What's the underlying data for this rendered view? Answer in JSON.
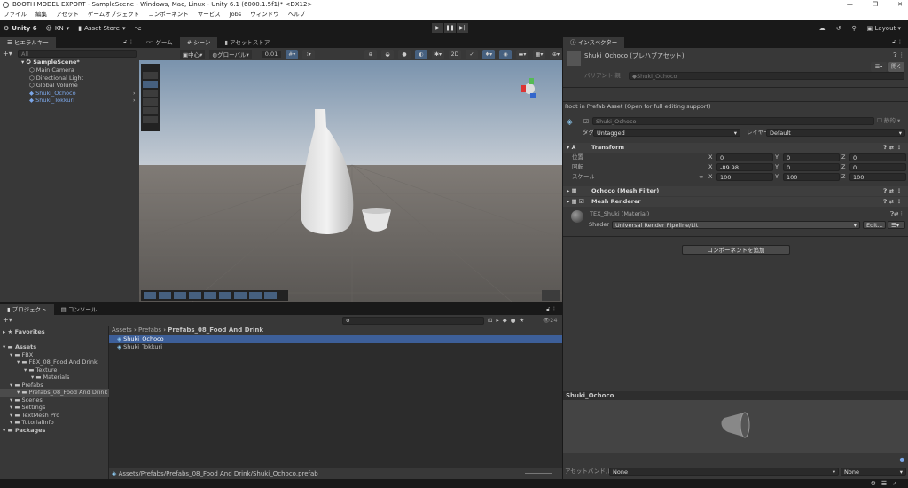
{
  "window": {
    "title": "BOOTH MODEL EXPORT - SampleScene - Windows, Mac, Linux - Unity 6.1 (6000.1.5f1)* <DX12>",
    "controls": [
      "—",
      "❐",
      "✕"
    ]
  },
  "menu": [
    "ファイル",
    "編集",
    "アセット",
    "ゲームオブジェクト",
    "コンポーネント",
    "サービス",
    "Jobs",
    "ウィンドウ",
    "ヘルプ"
  ],
  "toolbar": {
    "unity": "Unity 6",
    "account": "KN",
    "asset_store": "Asset Store",
    "layout": "Layout"
  },
  "hierarchy": {
    "tab": "ヒエラルキー",
    "search_placeholder": "All",
    "scene": "SampleScene*",
    "items": [
      {
        "label": "Main Camera",
        "prefab": false
      },
      {
        "label": "Directional Light",
        "prefab": false
      },
      {
        "label": "Global Volume",
        "prefab": false
      },
      {
        "label": "Shuki_Ochoco",
        "prefab": true
      },
      {
        "label": "Shuki_Tokkuri",
        "prefab": true
      }
    ]
  },
  "scene_view": {
    "tabs": [
      "ゲーム",
      "シーン",
      "アセットストア"
    ],
    "active_tab": 1,
    "pivot": "中心",
    "space": "グローバル",
    "snap": "0.01"
  },
  "inspector": {
    "tab": "インスペクター",
    "title": "Shuki_Ochoco (プレハブアセット)",
    "open_button": "開く",
    "variant_label": "バリアント 親",
    "variant_value": "Shuki_Ochoco",
    "root_note": "Root in Prefab Asset (Open for full editing support)",
    "object_name": "Shuki_Ochoco",
    "static_label": "静的",
    "tag_label": "タグ",
    "tag": "Untagged",
    "layer_label": "レイヤー",
    "layer": "Default",
    "transform": {
      "title": "Transform",
      "rows": [
        {
          "label": "位置",
          "x": "0",
          "y": "0",
          "z": "0"
        },
        {
          "label": "回転",
          "x": "-89.98",
          "y": "0",
          "z": "0"
        },
        {
          "label": "スケール",
          "x": "100",
          "y": "100",
          "z": "100"
        }
      ]
    },
    "mesh_filter": "Ochoco (Mesh Filter)",
    "mesh_renderer": "Mesh Renderer",
    "material": "TEX_Shuki (Material)",
    "shader_label": "Shader",
    "shader": "Universal Render Pipeline/Lit",
    "edit_button": "Edit...",
    "add_component": "コンポーネントを追加",
    "preview_title": "Shuki_Ochoco",
    "asset_bundle_label": "アセットバンドル",
    "asset_bundle": "None",
    "asset_bundle_variant": "None"
  },
  "project": {
    "tabs": [
      "プロジェクト",
      "コンソール"
    ],
    "visible_count": "24",
    "tree": [
      {
        "label": "Favorites",
        "depth": 0,
        "bold": true
      },
      {
        "label": "Assets",
        "depth": 0,
        "bold": true
      },
      {
        "label": "FBX",
        "depth": 1
      },
      {
        "label": "FBX_08_Food And Drink",
        "depth": 2
      },
      {
        "label": "Texture",
        "depth": 3
      },
      {
        "label": "Materials",
        "depth": 4
      },
      {
        "label": "Prefabs",
        "depth": 1
      },
      {
        "label": "Prefabs_08_Food And Drink",
        "depth": 2,
        "selected": true
      },
      {
        "label": "Scenes",
        "depth": 1
      },
      {
        "label": "Settings",
        "depth": 1
      },
      {
        "label": "TextMesh Pro",
        "depth": 1
      },
      {
        "label": "TutorialInfo",
        "depth": 1
      },
      {
        "label": "Packages",
        "depth": 0,
        "bold": true
      }
    ],
    "breadcrumb": [
      "Assets",
      "Prefabs",
      "Prefabs_08_Food And Drink"
    ],
    "files": [
      {
        "label": "Shuki_Ochoco",
        "selected": true
      },
      {
        "label": "Shuki_Tokkuri",
        "selected": false
      }
    ],
    "path": "Assets/Prefabs/Prefabs_08_Food And Drink/Shuki_Ochoco.prefab"
  },
  "colors": {
    "selection": "#3d5f99",
    "panel": "#383838",
    "prefab_text": "#7ba6e8"
  }
}
